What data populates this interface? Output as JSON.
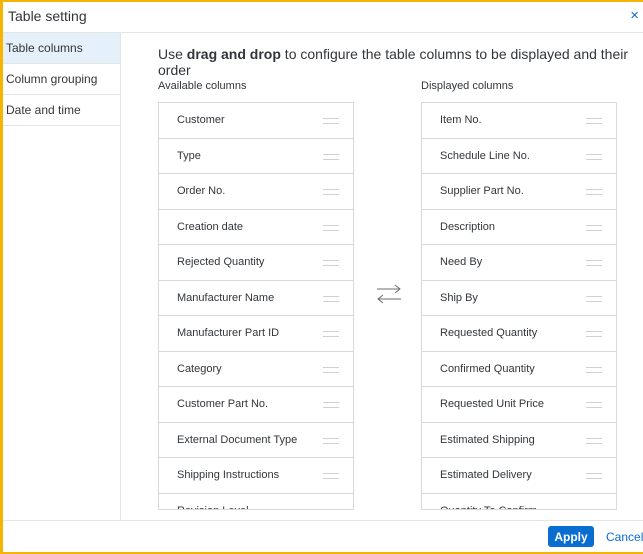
{
  "dialog": {
    "title": "Table setting",
    "close_icon": "×"
  },
  "sidebar": {
    "items": [
      {
        "label": "Table columns",
        "active": true
      },
      {
        "label": "Column grouping",
        "active": false
      },
      {
        "label": "Date and time",
        "active": false
      }
    ]
  },
  "instructions": {
    "prefix": "Use ",
    "bold": "drag and drop",
    "suffix": " to configure the table columns to be displayed and their order"
  },
  "available": {
    "label": "Available columns",
    "items": [
      "Customer",
      "Type",
      "Order No.",
      "Creation date",
      "Rejected Quantity",
      "Manufacturer Name",
      "Manufacturer Part ID",
      "Category",
      "Customer Part No.",
      "External Document Type",
      "Shipping Instructions",
      "Revision Level"
    ]
  },
  "displayed": {
    "label": "Displayed columns",
    "items": [
      "Item No.",
      "Schedule Line No.",
      "Supplier Part No.",
      "Description",
      "Need By",
      "Ship By",
      "Requested Quantity",
      "Confirmed Quantity",
      "Requested Unit Price",
      "Estimated Shipping",
      "Estimated Delivery",
      "Quantity To Confirm"
    ]
  },
  "footer": {
    "apply_label": "Apply",
    "cancel_label": "Cancel"
  },
  "colors": {
    "accent": "#0a6ed1",
    "highlight_border": "#f5b400",
    "active_nav": "#e5f0fa"
  },
  "icons": {
    "close": "close-icon",
    "swap": "swap-arrows-icon",
    "handle": "drag-handle-icon"
  }
}
